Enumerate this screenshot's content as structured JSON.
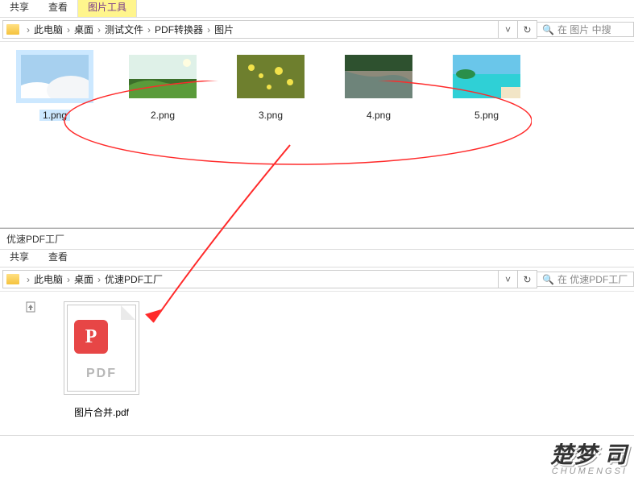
{
  "window1": {
    "tabs": {
      "share": "共享",
      "view": "查看",
      "imagetools": "图片工具"
    },
    "breadcrumb": [
      "此电脑",
      "桌面",
      "测试文件",
      "PDF转换器",
      "图片"
    ],
    "search_placeholder": "在 图片 中搜",
    "files": [
      {
        "name": "1.png",
        "selected": true
      },
      {
        "name": "2.png",
        "selected": false
      },
      {
        "name": "3.png",
        "selected": false
      },
      {
        "name": "4.png",
        "selected": false
      },
      {
        "name": "5.png",
        "selected": false
      }
    ]
  },
  "window2": {
    "title": "优速PDF工厂",
    "tabs": {
      "share": "共享",
      "view": "查看"
    },
    "breadcrumb": [
      "此电脑",
      "桌面",
      "优速PDF工厂"
    ],
    "search_placeholder": "在 优速PDF工厂",
    "pdf_badge_letter": "P",
    "pdf_text": "PDF",
    "file_name": "图片合并.pdf"
  },
  "watermark": {
    "line1": "楚梦 司",
    "line2": "CHUMENGSI"
  }
}
